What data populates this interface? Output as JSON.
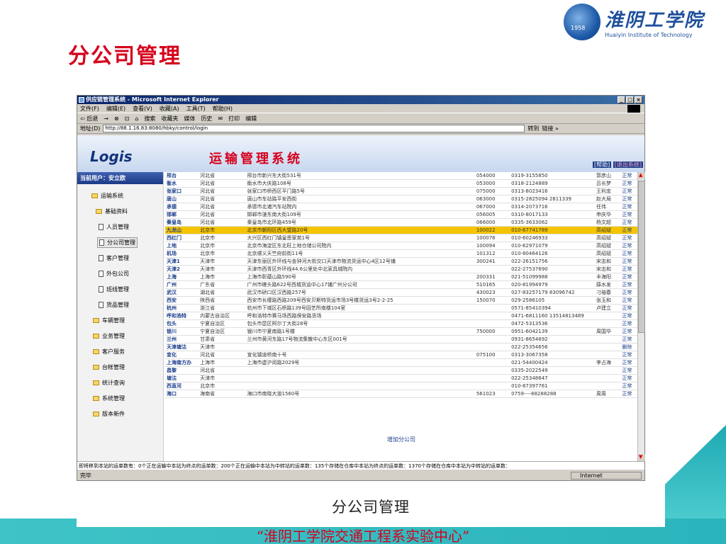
{
  "slide": {
    "title": "分公司管理",
    "logo_cn": "淮阴工学院",
    "logo_en": "Huaiyin Institute of Technology",
    "logo_year": "1958",
    "footer": "“淮阴工学院交通工程系实验中心”",
    "caption": "分公司管理"
  },
  "browser": {
    "window_title": "供应链管理系统 - Microsoft Internet Explorer",
    "menus": [
      "文件(F)",
      "编辑(E)",
      "查看(V)",
      "收藏(A)",
      "工具(T)",
      "帮助(H)"
    ],
    "toolbar": [
      "⇦ 后退",
      "→",
      "⊗",
      "⊡",
      "⌂",
      "搜索",
      "收藏夹",
      "媒体",
      "历史",
      "✉",
      "打印",
      "编辑"
    ],
    "address_label": "地址(D)",
    "address": "http://88.1.16.83:8080/hbky/control/login",
    "go": "转到",
    "links": "链接 »",
    "status": "完毕",
    "zone": "Internet"
  },
  "app": {
    "brand": "Logis",
    "system_title": "运输管理系统",
    "help": "[帮助]",
    "exit": "[退出系统]",
    "current_user": "当前用户：安立欧",
    "menu": {
      "transport": "运输系统",
      "basic": "基础资料",
      "staff": "人员管理",
      "branch": "分公司管理",
      "customer": "客户管理",
      "outsource": "外包公司",
      "route": "班线管理",
      "goods": "货品管理",
      "vehicle": "车辆管理",
      "business": "业务管理",
      "service": "客户服务",
      "finance": "台帐管理",
      "stats": "统计查询",
      "sysadmin": "系统管理",
      "updates": "版本新件"
    },
    "add_branch": "增加分公司",
    "ticker": "即将移到本站的运单数有：0个正在运输中本站为终点的运单数：200个正在运输中本站为中转站的运单数：135个存储在仓库中本站为终点的运单数：1370个存储在仓库中本站为中转站的运单数："
  },
  "branches": [
    [
      "邢台",
      "河北省",
      "邢台市新兴东大街531号",
      "054000",
      "0319-3155850",
      "郭彦山",
      "正常"
    ],
    [
      "衡水",
      "河北省",
      "衡水市大庆路108号",
      "053000",
      "0318-2124889",
      "吕长梦",
      "正常"
    ],
    [
      "张家口",
      "河北省",
      "张家口市桥西区平门路5号",
      "075000",
      "0313-8023416",
      "王利忠",
      "正常"
    ],
    [
      "唐山",
      "河北省",
      "唐山市车站路平安西街",
      "063000",
      "0315-2825094 2811339",
      "赵大局",
      "正常"
    ],
    [
      "承德",
      "河北省",
      "承德市北诸汽车站院内",
      "067000",
      "0314-2073716",
      "任伟",
      "正常"
    ],
    [
      "邯郸",
      "河北省",
      "邯郸市滏东南大街109号",
      "056005",
      "0310-8017133",
      "申庆华",
      "正常"
    ],
    [
      "秦皇岛",
      "河北省",
      "秦皇岛市北环路459号",
      "066000",
      "0335-3633062",
      "杨文超",
      "正常"
    ],
    [
      "九龙山",
      "北京市",
      "北京市朝阳区西大望路20号",
      "100022",
      "010-67741789",
      "高绍斌",
      "正常"
    ],
    [
      "西红门",
      "北京市",
      "大兴区西红门镇皇恩家苑1号",
      "100076",
      "010-60246933",
      "高绍斌",
      "正常"
    ],
    [
      "上地",
      "北京市",
      "北京市海淀区东北旺上地仓储公司院内",
      "100094",
      "010-62971079",
      "高绍斌",
      "正常"
    ],
    [
      "机场",
      "北京市",
      "北京顺义天竺府前街11号",
      "101312",
      "010-80464126",
      "高绍斌",
      "正常"
    ],
    [
      "天津1",
      "天津市",
      "天津东丽区外环线与金钟河大街交口天津市物流货运中心4区12号铺",
      "300241",
      "022-26151756",
      "宋志和",
      "正常"
    ],
    [
      "天津2",
      "天津市",
      "天津市西青区外环线44.6公里处中北家具城院内",
      "",
      "022-27537690",
      "宋志和",
      "正常"
    ],
    [
      "上海",
      "上海市",
      "上海市彰蕴山路590号",
      "200331",
      "021-51099988",
      "丰海阳",
      "正常"
    ],
    [
      "广州",
      "广东省",
      "广州市槎头路622号西城货运中心17铺广州分公司",
      "510165",
      "020-81994979",
      "薛水发",
      "正常"
    ],
    [
      "武汉",
      "湖北省",
      "武汉市硚口区汉西路257号",
      "430023",
      "027-83257179 83096742",
      "刁袖春",
      "正常"
    ],
    [
      "西安",
      "陕西省",
      "西安市长缨路西路209号西安贝斯特货运市场3号楼货运3号2-2-25",
      "150070",
      "029-2586105",
      "张玉和",
      "正常"
    ],
    [
      "杭州",
      "浙江省",
      "杭州市下城区石桥路139号园艺所南楼104室",
      "",
      "0571-85410394",
      "卢建立",
      "正常"
    ],
    [
      "呼和浩特",
      "内蒙古自治区",
      "呼和浩特市赛马场西路保安路货场",
      "",
      "0471-6811160 13514813489",
      "",
      "正常"
    ],
    [
      "包头",
      "宁夏自治区",
      "包头市昆区阿尔丁大街28号",
      "",
      "0472-5313536",
      "",
      "正常"
    ],
    [
      "银川",
      "宁夏自治区",
      "银川市宁夏南路1号楼",
      "750000",
      "0951-6042139",
      "周国华",
      "正常"
    ],
    [
      "兰州",
      "甘肃省",
      "兰州市黄河东路17号物流集散中心东区001号",
      "",
      "0931-8654692",
      "",
      "正常"
    ],
    [
      "天津塘沽",
      "天津市",
      "",
      "",
      "022-25354656",
      "",
      "删除"
    ],
    [
      "宣化",
      "河北省",
      "宣化镇迪桥南十号",
      "075100",
      "0313-3067358",
      "",
      "正常"
    ],
    [
      "上海南方办",
      "上海市",
      "上海市虚沪闵路2029号",
      "",
      "021-54400424",
      "李占海",
      "正常"
    ],
    [
      "昌黎",
      "河北省",
      "",
      "",
      "0335-2022549",
      "",
      "正常"
    ],
    [
      "塘沽",
      "天津市",
      "",
      "",
      "022-25348647",
      "",
      "正常"
    ],
    [
      "西直河",
      "北京市",
      "",
      "",
      "010-87397761",
      "",
      "正常"
    ],
    [
      "海口",
      "海南省",
      "海口市南晓大道1560号",
      "561023",
      "0759----88288288",
      "周周",
      "正常"
    ]
  ],
  "highlight_row": 7
}
